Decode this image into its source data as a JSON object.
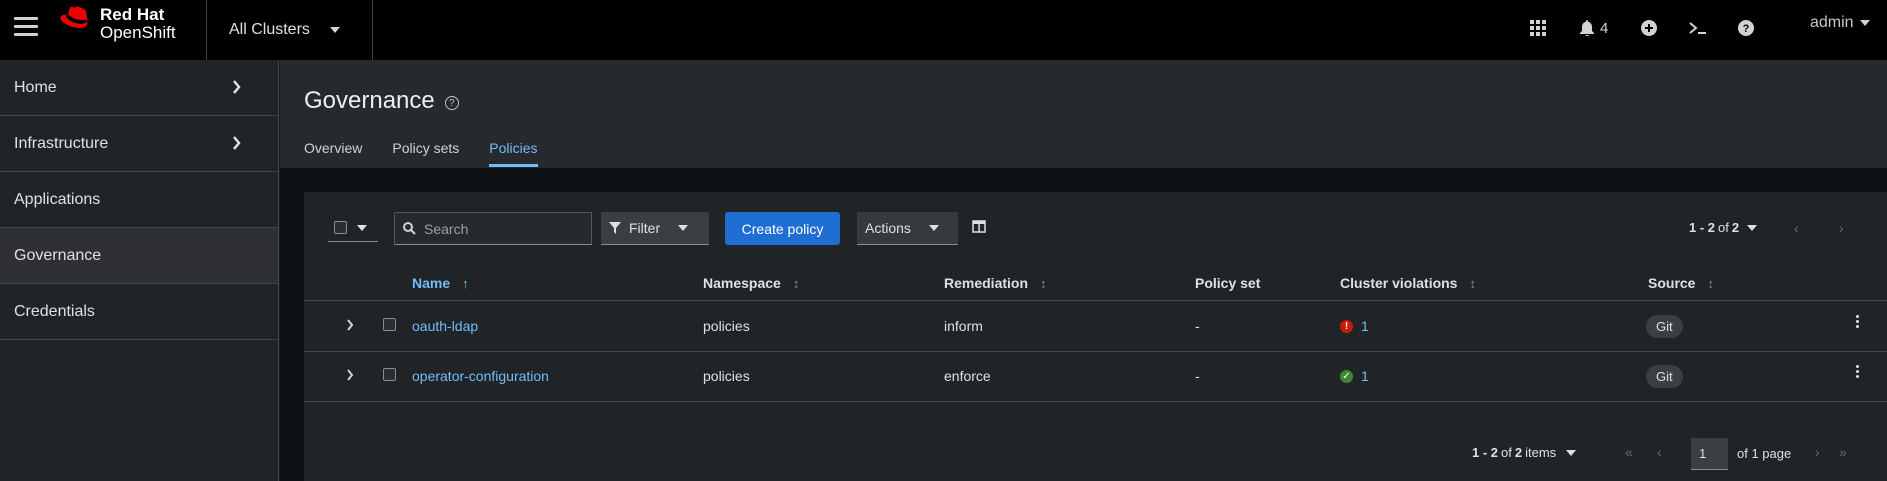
{
  "masthead": {
    "brand_line1": "Red Hat",
    "brand_line2": "OpenShift",
    "cluster_selector": "All Clusters",
    "notifications_count": "4",
    "user": "admin"
  },
  "sidebar": {
    "items": [
      {
        "label": "Home",
        "has_children": true
      },
      {
        "label": "Infrastructure",
        "has_children": true
      },
      {
        "label": "Applications",
        "has_children": false
      },
      {
        "label": "Governance",
        "has_children": false,
        "active": true
      },
      {
        "label": "Credentials",
        "has_children": false
      }
    ]
  },
  "header": {
    "title": "Governance",
    "tabs": [
      {
        "label": "Overview"
      },
      {
        "label": "Policy sets"
      },
      {
        "label": "Policies",
        "active": true
      }
    ]
  },
  "toolbar": {
    "search_placeholder": "Search",
    "filter_label": "Filter",
    "create_label": "Create policy",
    "actions_label": "Actions",
    "pagination_range": "1 - 2",
    "pagination_of": "of",
    "pagination_total": "2"
  },
  "table": {
    "columns": [
      "Name",
      "Namespace",
      "Remediation",
      "Policy set",
      "Cluster violations",
      "Source"
    ],
    "rows": [
      {
        "name": "oauth-ldap",
        "namespace": "policies",
        "remediation": "inform",
        "policy_set": "-",
        "violations": "1",
        "violation_status": "danger",
        "source": "Git"
      },
      {
        "name": "operator-configuration",
        "namespace": "policies",
        "remediation": "enforce",
        "policy_set": "-",
        "violations": "1",
        "violation_status": "success",
        "source": "Git"
      }
    ]
  },
  "footer": {
    "items_range": "1 - 2",
    "items_of": "of",
    "items_total": "2",
    "items_word": "items",
    "page_value": "1",
    "of_pages": "of 1 page"
  },
  "colors": {
    "accent": "#73bcf7",
    "primary_button": "#1f6ed4",
    "danger": "#c9190b",
    "success": "#3e8635"
  }
}
